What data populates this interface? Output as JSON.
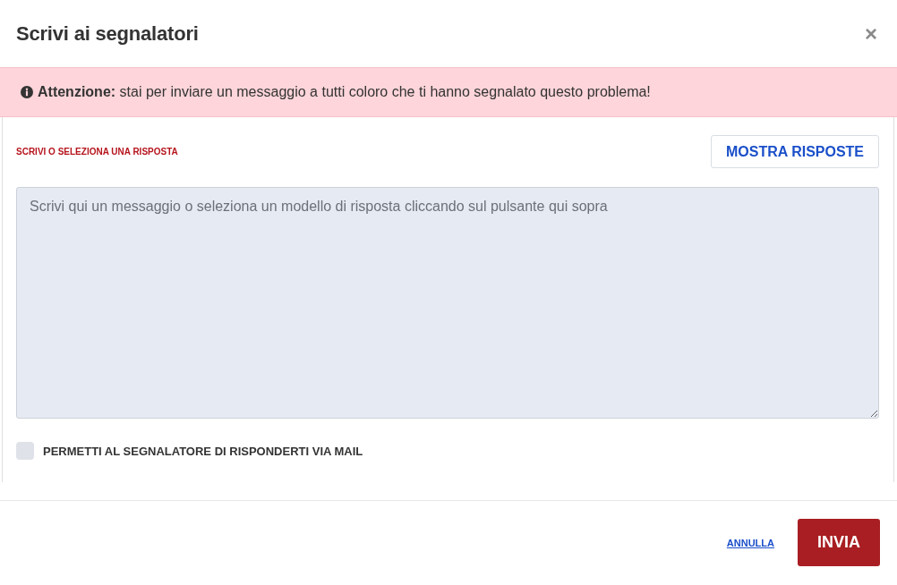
{
  "dialog": {
    "title": "Scrivi ai segnalatori",
    "close": "×"
  },
  "alert": {
    "text": "**Attenzione:** stai per inviare un messaggio a tutti coloro che ti hanno segnalato questo problema!"
  },
  "reply": {
    "label": "SCRIVI O SELEZIONA UNA RISPOSTA",
    "show_button": "MOSTRA RISPOSTE",
    "message": {
      "placeholder": "Scrivi qui un messaggio o seleziona un modello di risposta cliccando sul pulsante qui sopra"
    }
  },
  "allow_reply": {
    "label": "PERMETTI AL SEGNALATORE DI RISPONDERTI VIA MAIL",
    "checked": false
  },
  "footer": {
    "buttons": [
      {
        "label": "ANNULLA",
        "kind": "link"
      },
      {
        "label": "INVIA",
        "kind": "primary"
      }
    ]
  }
}
